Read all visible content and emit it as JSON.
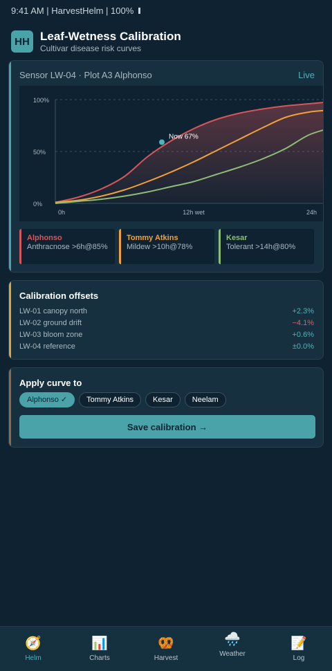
{
  "status_bar": {
    "text": "9:41 AM | HarvestHelm | 100%"
  },
  "header": {
    "logo": "HH",
    "title": "Leaf-Wetness Calibration",
    "subtitle": "Cultivar disease risk curves"
  },
  "sensor": {
    "name": "Sensor LW-04 · Plot A3 Alphonso",
    "status": "Live",
    "accent": "#4aa3a8"
  },
  "chart_data": {
    "type": "line",
    "x_unit": "hours wet",
    "xlim": [
      0,
      24
    ],
    "ylim": [
      0,
      100
    ],
    "y_ticks": [
      "100%",
      "50%",
      "0%"
    ],
    "x_ticks": [
      "0h",
      "12h wet",
      "24h"
    ],
    "grid": true,
    "series": [
      {
        "name": "Alphonso",
        "color": "#d5575b",
        "x": [
          0,
          2,
          4,
          6,
          8,
          10,
          12,
          14,
          16,
          18,
          20,
          22,
          24
        ],
        "y": [
          1,
          6,
          14,
          26,
          45,
          60,
          72,
          81,
          87,
          91,
          94,
          96,
          98
        ]
      },
      {
        "name": "Tommy Atkins",
        "color": "#f2a23a",
        "x": [
          0,
          2,
          4,
          6,
          8,
          10,
          12,
          14,
          16,
          18,
          20,
          22,
          24
        ],
        "y": [
          1,
          3,
          7,
          13,
          21,
          30,
          40,
          51,
          62,
          73,
          83,
          88,
          90
        ]
      },
      {
        "name": "Kesar",
        "color": "#8dbd77",
        "x": [
          0,
          2,
          4,
          6,
          8,
          10,
          12,
          14,
          16,
          18,
          20,
          22,
          24
        ],
        "y": [
          0,
          2,
          4,
          7,
          11,
          16,
          21,
          28,
          35,
          43,
          53,
          66,
          73
        ]
      }
    ],
    "marker": {
      "x": 9,
      "y": 67,
      "label": "Now 67%",
      "color": "#4fb3b8"
    }
  },
  "legend": [
    {
      "name": "Alphonso",
      "desc": "Anthracnose >6h@85%",
      "color": "#d5575b"
    },
    {
      "name": "Tommy Atkins",
      "desc": "Mildew >10h@78%",
      "color": "#f2a23a"
    },
    {
      "name": "Kesar",
      "desc": "Tolerant >14h@80%",
      "color": "#8dbd77"
    }
  ],
  "offsets": {
    "title": "Calibration offsets",
    "accent": "#e0a43a",
    "rows": [
      {
        "label": "LW-01 canopy north",
        "value": "+2.3%",
        "color": "#4fb3b8"
      },
      {
        "label": "LW-02 ground drift",
        "value": "−4.1%",
        "color": "#e25c5c"
      },
      {
        "label": "LW-03 bloom zone",
        "value": "+0.6%",
        "color": "#4fb3b8"
      },
      {
        "label": "LW-04 reference",
        "value": "±0.0%",
        "color": "#4fb3b8"
      }
    ]
  },
  "apply": {
    "title": "Apply curve to",
    "accent": "#8a6a4a",
    "chips": [
      {
        "label": "Alphonso ✓",
        "selected": true
      },
      {
        "label": "Tommy Atkins",
        "selected": false
      },
      {
        "label": "Kesar",
        "selected": false
      },
      {
        "label": "Neelam",
        "selected": false
      }
    ],
    "save_label": "Save calibration →"
  },
  "nav": [
    {
      "label": "Helm",
      "icon": "🧭",
      "icon_name": "compass-icon",
      "active": true
    },
    {
      "label": "Charts",
      "icon": "📊",
      "icon_name": "bar-chart-icon",
      "active": false
    },
    {
      "label": "Harvest",
      "icon": "🥨",
      "icon_name": "pretzel-icon",
      "active": false
    },
    {
      "label": "Weather",
      "icon": "🌧️",
      "icon_name": "rain-cloud-icon",
      "active": false
    },
    {
      "label": "Log",
      "icon": "📝",
      "icon_name": "memo-icon",
      "active": false
    }
  ]
}
